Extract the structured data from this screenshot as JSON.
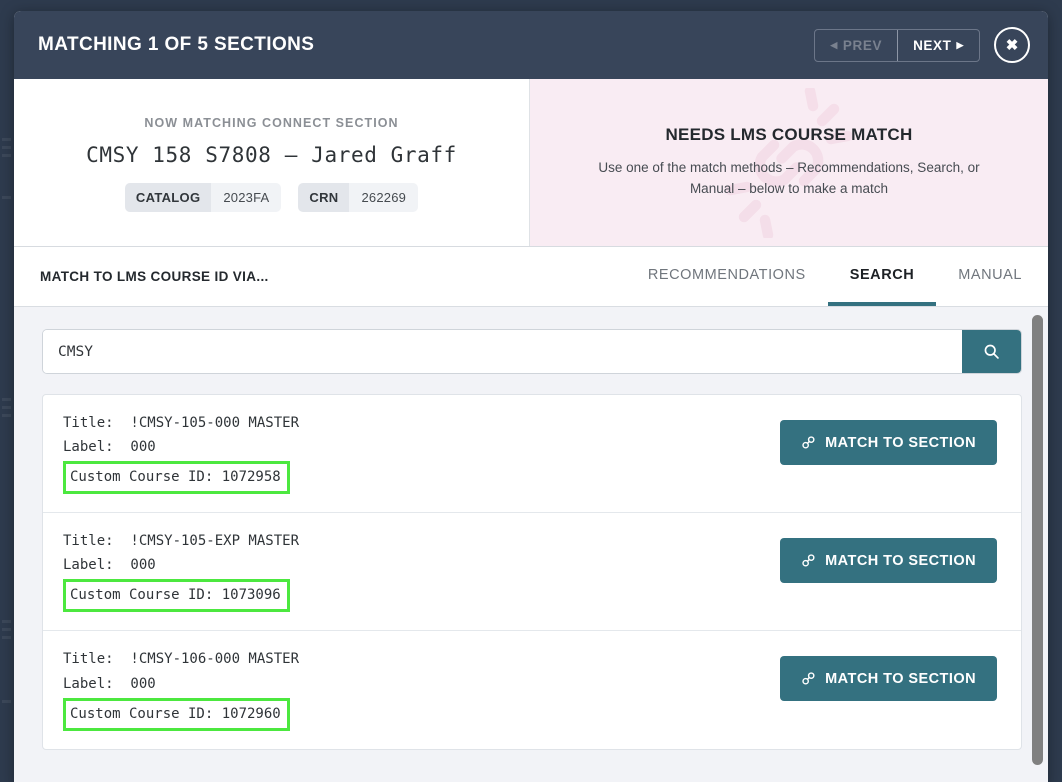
{
  "header": {
    "title": "MATCHING 1 OF 5 SECTIONS",
    "prev_label": "PREV",
    "next_label": "NEXT",
    "close_label": "✖",
    "prev_disabled": true
  },
  "section_info": {
    "eyebrow": "NOW MATCHING CONNECT SECTION",
    "section_name": "CMSY 158 S7808 – Jared Graff",
    "badges": [
      {
        "key": "CATALOG",
        "value": "2023FA"
      },
      {
        "key": "CRN",
        "value": "262269"
      }
    ]
  },
  "status_panel": {
    "title": "NEEDS LMS COURSE MATCH",
    "description": "Use one of the match methods – Recommendations, Search, or Manual – below to make a match",
    "background_color": "#f9ecf3",
    "watermark_icon": "broken-link-icon"
  },
  "tabbar": {
    "label": "MATCH TO LMS COURSE ID VIA...",
    "tabs": [
      {
        "label": "RECOMMENDATIONS",
        "active": false
      },
      {
        "label": "SEARCH",
        "active": true
      },
      {
        "label": "MANUAL",
        "active": false
      }
    ],
    "active_underline_color": "#347180"
  },
  "search": {
    "value": "CMSY",
    "placeholder": "",
    "button_icon": "search-icon",
    "button_color": "#347180"
  },
  "results": {
    "match_button_label": "MATCH TO SECTION",
    "match_button_icon": "link-icon",
    "title_prefix": "Title:",
    "label_prefix": "Label:",
    "ccid_prefix": "Custom Course ID:",
    "highlight_color": "#4ce83f",
    "items": [
      {
        "title_line": "Title:  !CMSY-105-000 MASTER",
        "label_line": "Label:  000",
        "ccid_line": "Custom Course ID: 1072958",
        "title": "!CMSY-105-000 MASTER",
        "label": "000",
        "custom_course_id": "1072958"
      },
      {
        "title_line": "Title:  !CMSY-105-EXP MASTER",
        "label_line": "Label:  000",
        "ccid_line": "Custom Course ID: 1073096",
        "title": "!CMSY-105-EXP MASTER",
        "label": "000",
        "custom_course_id": "1073096"
      },
      {
        "title_line": "Title:  !CMSY-106-000 MASTER",
        "label_line": "Label:  000",
        "ccid_line": "Custom Course ID: 1072960",
        "title": "!CMSY-106-000 MASTER",
        "label": "000",
        "custom_course_id": "1072960"
      }
    ]
  }
}
